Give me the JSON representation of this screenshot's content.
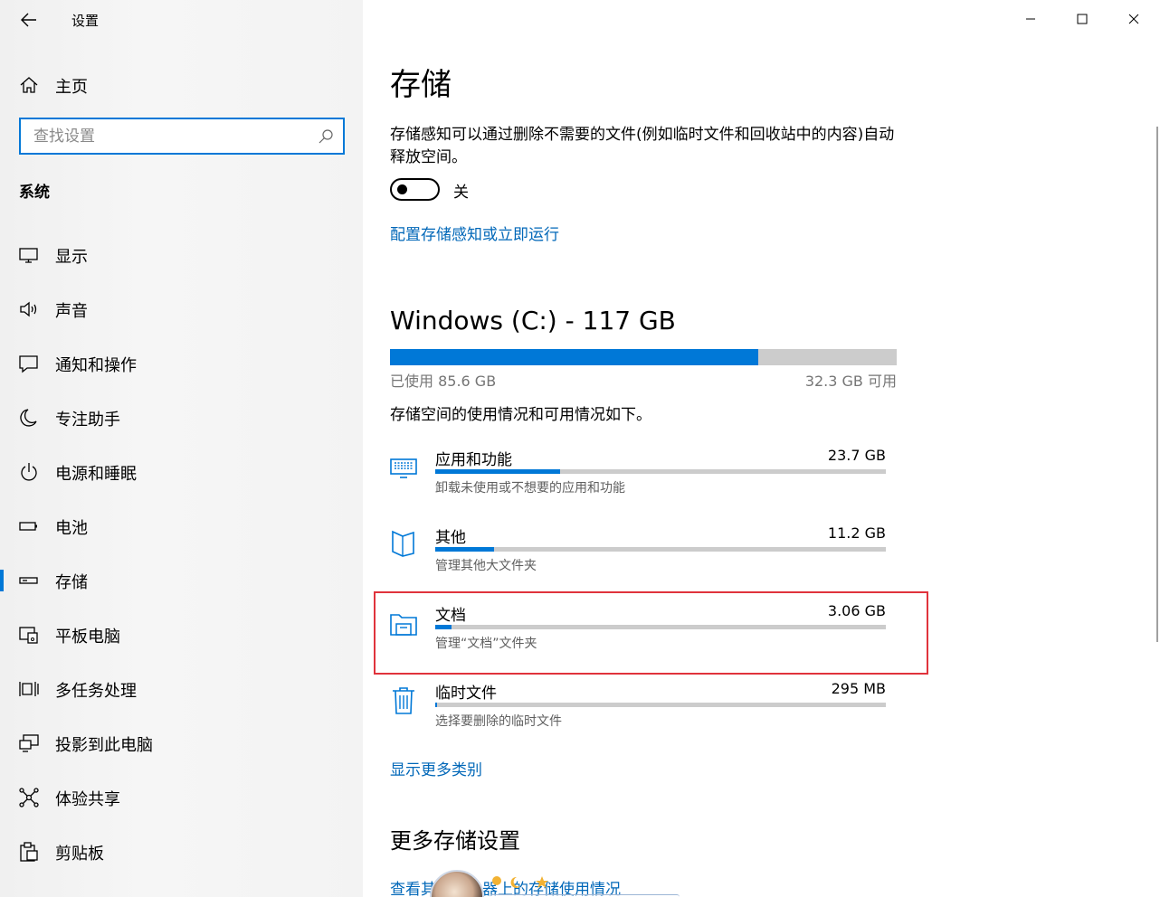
{
  "window": {
    "app_title": "设置"
  },
  "sidebar": {
    "home_label": "主页",
    "search_placeholder": "查找设置",
    "section_title": "系统",
    "items": [
      {
        "label": "显示",
        "icon": "monitor-icon"
      },
      {
        "label": "声音",
        "icon": "speaker-icon"
      },
      {
        "label": "通知和操作",
        "icon": "notification-icon"
      },
      {
        "label": "专注助手",
        "icon": "moon-icon"
      },
      {
        "label": "电源和睡眠",
        "icon": "power-icon"
      },
      {
        "label": "电池",
        "icon": "battery-icon"
      },
      {
        "label": "存储",
        "icon": "drive-icon",
        "active": true
      },
      {
        "label": "平板电脑",
        "icon": "tablet-icon"
      },
      {
        "label": "多任务处理",
        "icon": "multitask-icon"
      },
      {
        "label": "投影到此电脑",
        "icon": "project-icon"
      },
      {
        "label": "体验共享",
        "icon": "share-icon"
      },
      {
        "label": "剪贴板",
        "icon": "clipboard-icon"
      }
    ]
  },
  "main": {
    "title": "存储",
    "description": "存储感知可以通过删除不需要的文件(例如临时文件和回收站中的内容)自动释放空间。",
    "toggle_state": "关",
    "configure_link": "配置存储感知或立即运行",
    "drive": {
      "title": "Windows (C:) - 117 GB",
      "used_text": "已使用 85.6 GB",
      "free_text": "32.3 GB 可用",
      "used_fraction": 0.726
    },
    "usage_description": "存储空间的使用情况和可用情况如下。",
    "categories": [
      {
        "name": "应用和功能",
        "size": "23.7 GB",
        "sub": "卸载未使用或不想要的应用和功能",
        "fraction": 0.277,
        "icon": "apps-icon"
      },
      {
        "name": "其他",
        "size": "11.2 GB",
        "sub": "管理其他大文件夹",
        "fraction": 0.131,
        "icon": "other-folder-icon"
      },
      {
        "name": "文档",
        "size": "3.06 GB",
        "sub": "管理“文档”文件夹",
        "fraction": 0.036,
        "icon": "documents-icon"
      },
      {
        "name": "临时文件",
        "size": "295 MB",
        "sub": "选择要删除的临时文件",
        "fraction": 0.004,
        "icon": "trash-icon"
      }
    ],
    "show_more_link": "显示更多类别",
    "more_settings_title": "更多存储设置",
    "bottom_link": "查看其他驱动器上的存储使用情况"
  },
  "colors": {
    "accent": "#0078d7",
    "link": "#0067b8",
    "highlight_box": "#e0333c",
    "bar_bg": "#cccccc"
  }
}
